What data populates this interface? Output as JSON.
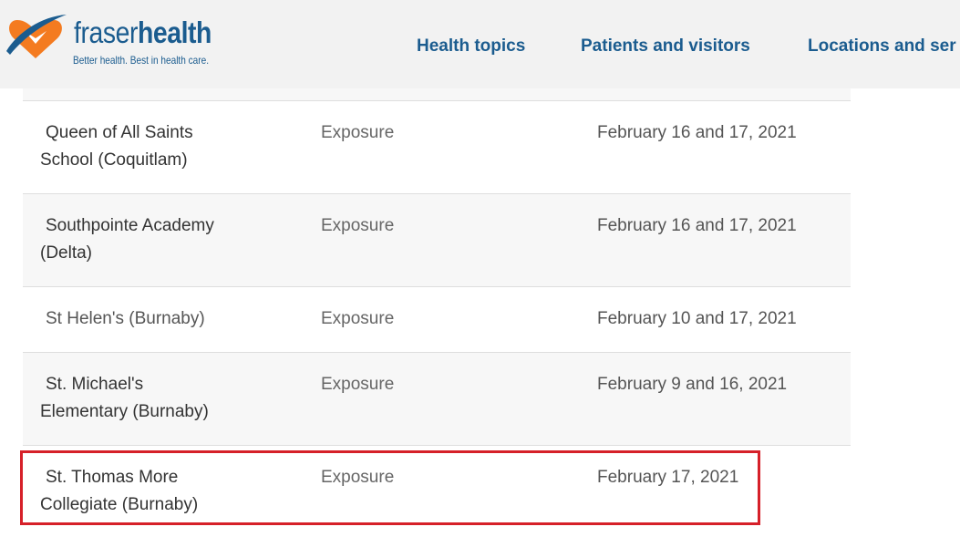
{
  "brand": {
    "name_light": "fraser",
    "name_bold": "health",
    "tagline": "Better health. Best in health care.",
    "colors": {
      "primary": "#1b5c8f",
      "accent": "#f47b20",
      "highlight": "#d62029"
    }
  },
  "nav": {
    "items": [
      {
        "label": "Health topics"
      },
      {
        "label": "Patients and visitors"
      },
      {
        "label": "Locations and ser"
      }
    ]
  },
  "exposures": {
    "rows": [
      {
        "school_line1": "Queen of All Saints",
        "school_line2": "School (Coquitlam)",
        "type": "Exposure",
        "dates": "February 16 and 17, 2021"
      },
      {
        "school_line1": "Southpointe Academy",
        "school_line2": "(Delta)",
        "type": "Exposure",
        "dates": "February 16 and 17, 2021"
      },
      {
        "school_line1": "St Helen's (Burnaby)",
        "school_line2": "",
        "type": "Exposure",
        "dates": "February 10 and 17, 2021"
      },
      {
        "school_line1": "St. Michael's",
        "school_line2": "Elementary (Burnaby)",
        "type": "Exposure",
        "dates": "February 9 and 16, 2021"
      },
      {
        "school_line1": "St. Thomas More",
        "school_line2": "Collegiate (Burnaby)",
        "type": "Exposure",
        "dates": "February 17, 2021"
      }
    ]
  }
}
